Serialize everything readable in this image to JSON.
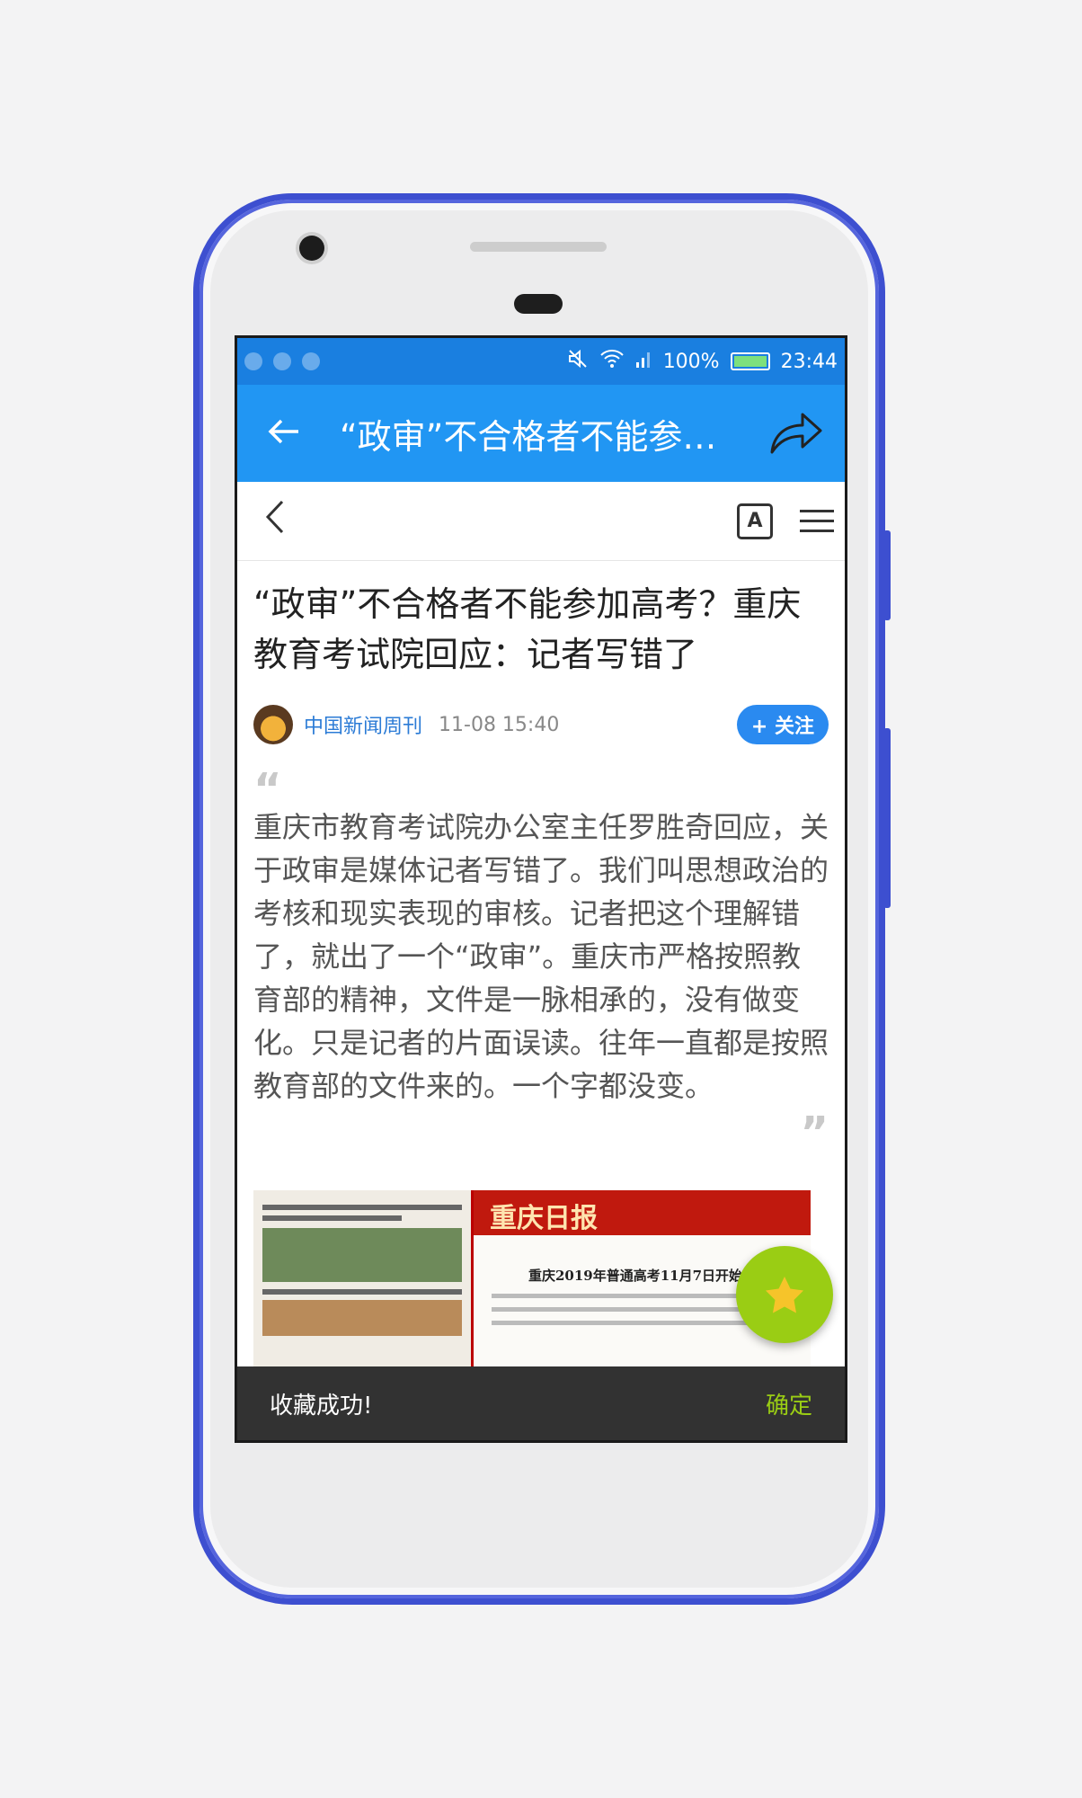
{
  "status_bar": {
    "battery": "100%",
    "time": "23:44"
  },
  "app_bar": {
    "title": "“政审”不合格者不能参…"
  },
  "article": {
    "headline": "“政审”不合格者不能参加高考？重庆教育考试院回应：记者写错了",
    "source": "中国新闻周刊",
    "time": "11-08 15:40",
    "follow_label": "关注",
    "quote": "重庆市教育考试院办公室主任罗胜奇回应，关于政审是媒体记者写错了。我们叫思想政治的考核和现实表现的审核。记者把这个理解错了，就出了一个“政审”。重庆市严格按照教育部的精神，文件是一脉相承的，没有做变化。只是记者的片面误读。往年一直都是按照教育部的文件来的。一个字都没变。"
  },
  "news_image": {
    "paper_name": "重庆日报",
    "paper_title": "重庆2019年普通高考11月7日开始报"
  },
  "snackbar": {
    "message": "收藏成功!",
    "action": "确定"
  },
  "colors": {
    "frame": "#3d4fd0",
    "app_bar": "#2196f3",
    "status_bar": "#1a7fe0",
    "accent_green": "#9acd14",
    "link_blue": "#2b7bd6"
  }
}
